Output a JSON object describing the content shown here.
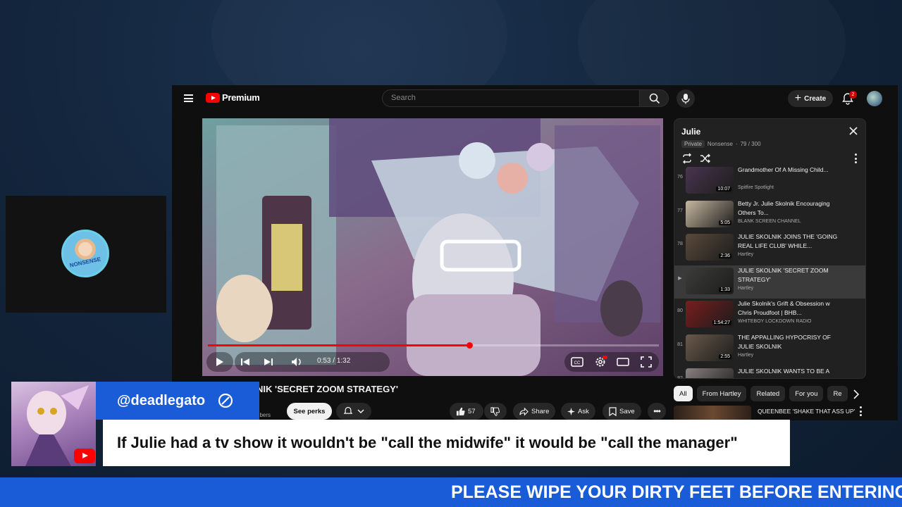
{
  "youtube": {
    "brand": "Premium",
    "search_placeholder": "Search",
    "create_label": "Create",
    "notification_count": "2"
  },
  "player": {
    "time_current": "0:53",
    "time_separator": " / ",
    "time_total": "1:32",
    "progress_fraction": 0.58
  },
  "video": {
    "title": "NIK 'SECRET ZOOM STRATEGY'",
    "subs_fragment": "ribers",
    "see_perks_label": "See perks",
    "like_count": "57",
    "share_label": "Share",
    "ask_label": "Ask",
    "save_label": "Save"
  },
  "playlist": {
    "title": "Julie",
    "privacy": "Private",
    "owner": "Nonsense",
    "position": "79 / 300",
    "items": [
      {
        "num": "76",
        "title": "Grandmother Of A Missing Child...",
        "channel": "Spitfire Spotlight",
        "duration": "10:07",
        "thumb": "#4a3550"
      },
      {
        "num": "77",
        "title": "Betty Jr. Julie Skolnik Encouraging Others To...",
        "channel": "BLANK SCREEN CHANNEL",
        "duration": "5:05",
        "thumb": "#c8b8a0"
      },
      {
        "num": "78",
        "title": "JULIE SKOLNIK JOINS THE 'GOING REAL LIFE CLUB' WHILE...",
        "channel": "Hartley",
        "duration": "2:36",
        "thumb": "#5a4a3a"
      },
      {
        "num": "",
        "title": "JULIE SKOLNIK 'SECRET ZOOM STRATEGY'",
        "channel": "Hartley",
        "duration": "1:33",
        "thumb": "#3c3c38"
      },
      {
        "num": "80",
        "title": "Julie Skolnik's Grift & Obsession w Chris Proudfoot | BHB...",
        "channel": "WHITEBOY LOCKDOWN RADIO",
        "duration": "1:54:27",
        "thumb": "#7a1d1d"
      },
      {
        "num": "81",
        "title": "THE APPALLING HYPOCRISY OF JULIE SKOLNIK",
        "channel": "Hartley",
        "duration": "2:55",
        "thumb": "#6a5a4a"
      },
      {
        "num": "82",
        "title": "JULIE SKOLNIK WANTS TO BE A REAL GIRL",
        "channel": "",
        "duration": "",
        "thumb": "#8a8080"
      }
    ]
  },
  "chips": [
    "All",
    "From Hartley",
    "Related",
    "For you",
    "Re"
  ],
  "recommendation": {
    "title": "QUEENBEE 'SHAKE THAT ASS UP'"
  },
  "stream_overlay": {
    "chat_username": "@deadlegato",
    "chat_message": "If Julie had a tv show it wouldn't be \"call the midwife\" it would be \"call the manager\"",
    "ticker_text": "PLEASE WIPE YOUR DIRTY FEET BEFORE ENTERING",
    "profile_label": "NONSENSE"
  },
  "colors": {
    "accent_blue": "#1a5cd8",
    "youtube_red": "#ff0000",
    "yt_dark": "#0f0f0f"
  }
}
